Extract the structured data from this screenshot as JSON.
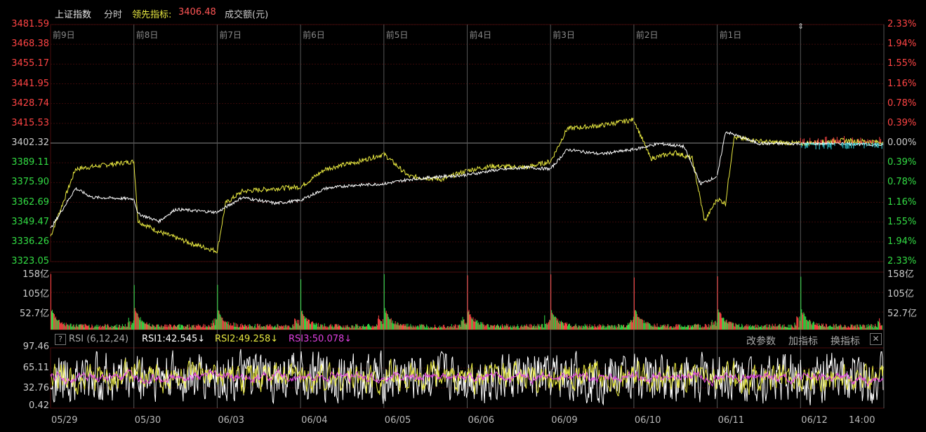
{
  "header": {
    "index_name": "上证指数",
    "period": "分时",
    "leading_label": "领先指标:",
    "leading_value": "3406.48",
    "volume_label": "成交额(元)"
  },
  "colors": {
    "up": "#ff4444",
    "down": "#33dd44",
    "price_line": "#ffffff",
    "leading_line": "#e8e840",
    "rsi1": "#ffffff",
    "rsi2": "#e8e840",
    "rsi3": "#e040e0",
    "grid": "#3a0a0a",
    "day_sep": "#555555",
    "ref_line": "#8a8a8a",
    "avg_cyan": "#33e0e8"
  },
  "price_axis": {
    "left_labels": [
      "3481.59",
      "3468.38",
      "3455.17",
      "3441.95",
      "3428.74",
      "3415.53",
      "3402.32",
      "3389.11",
      "3375.90",
      "3362.69",
      "3349.47",
      "3336.26",
      "3323.05"
    ],
    "right_labels": [
      "2.33%",
      "1.94%",
      "1.55%",
      "1.16%",
      "0.78%",
      "0.39%",
      "0.00%",
      "0.39%",
      "0.78%",
      "1.16%",
      "1.55%",
      "1.94%",
      "2.33%"
    ],
    "reference": 3402.32,
    "max": 3481.59,
    "min": 3323.05
  },
  "day_labels": [
    "前9日",
    "前8日",
    "前7日",
    "前6日",
    "前5日",
    "前4日",
    "前3日",
    "前2日",
    "前1日"
  ],
  "volume_axis": {
    "left_labels": [
      "158亿",
      "105亿",
      "52.7亿"
    ],
    "right_labels": [
      "158亿",
      "105亿",
      "52.7亿"
    ]
  },
  "rsi": {
    "help": "?",
    "name": "RSI (6,12,24)",
    "rsi1_label": "RSI1:42.545↓",
    "rsi2_label": "RSI2:49.258↓",
    "rsi3_label": "RSI3:50.078↓",
    "axis_labels": [
      "97.46",
      "65.11",
      "32.76",
      "0.42"
    ],
    "buttons": {
      "modify": "改参数",
      "add": "加指标",
      "switch": "换指标",
      "close": "✕"
    }
  },
  "x_axis_labels": [
    "05/29",
    "05/30",
    "06/03",
    "06/04",
    "06/05",
    "06/06",
    "06/09",
    "06/10",
    "06/11",
    "06/12",
    "14:00"
  ],
  "chart_data": {
    "type": "line",
    "title": "上证指数",
    "days": [
      "05/29",
      "05/30",
      "06/03",
      "06/04",
      "06/05",
      "06/06",
      "06/09",
      "06/10",
      "06/11",
      "06/12"
    ],
    "series": [
      {
        "name": "上证指数",
        "key_points": [
          [
            0,
            3345
          ],
          [
            0.3,
            3372
          ],
          [
            0.5,
            3366
          ],
          [
            1.0,
            3365
          ],
          [
            1.05,
            3355
          ],
          [
            1.3,
            3350
          ],
          [
            1.5,
            3358
          ],
          [
            2.0,
            3356
          ],
          [
            2.3,
            3366
          ],
          [
            2.7,
            3362
          ],
          [
            3.0,
            3364
          ],
          [
            3.3,
            3372
          ],
          [
            3.6,
            3374
          ],
          [
            4.0,
            3375
          ],
          [
            4.3,
            3378
          ],
          [
            4.7,
            3380
          ],
          [
            5.0,
            3381
          ],
          [
            5.3,
            3384
          ],
          [
            5.7,
            3386
          ],
          [
            6.0,
            3385
          ],
          [
            6.2,
            3398
          ],
          [
            6.6,
            3395
          ],
          [
            7.0,
            3398
          ],
          [
            7.3,
            3402
          ],
          [
            7.6,
            3400
          ],
          [
            7.8,
            3375
          ],
          [
            8.0,
            3380
          ],
          [
            8.1,
            3410
          ],
          [
            8.5,
            3402
          ],
          [
            9.0,
            3402
          ],
          [
            9.5,
            3402
          ],
          [
            9.99,
            3401
          ]
        ]
      },
      {
        "name": "领先指标",
        "key_points": [
          [
            0,
            3340
          ],
          [
            0.3,
            3385
          ],
          [
            0.7,
            3388
          ],
          [
            1.0,
            3390
          ],
          [
            1.05,
            3350
          ],
          [
            1.3,
            3343
          ],
          [
            1.7,
            3335
          ],
          [
            2.0,
            3330
          ],
          [
            2.1,
            3362
          ],
          [
            2.3,
            3370
          ],
          [
            2.7,
            3372
          ],
          [
            3.0,
            3373
          ],
          [
            3.3,
            3385
          ],
          [
            3.7,
            3390
          ],
          [
            4.0,
            3395
          ],
          [
            4.3,
            3380
          ],
          [
            4.7,
            3378
          ],
          [
            5.0,
            3384
          ],
          [
            5.3,
            3387
          ],
          [
            5.7,
            3386
          ],
          [
            6.0,
            3390
          ],
          [
            6.2,
            3412
          ],
          [
            6.6,
            3414
          ],
          [
            7.0,
            3418
          ],
          [
            7.2,
            3392
          ],
          [
            7.5,
            3396
          ],
          [
            7.7,
            3392
          ],
          [
            7.85,
            3350
          ],
          [
            8.0,
            3365
          ],
          [
            8.1,
            3362
          ],
          [
            8.2,
            3406
          ],
          [
            8.6,
            3403
          ],
          [
            9.0,
            3402
          ],
          [
            9.5,
            3404
          ],
          [
            9.99,
            3403
          ]
        ]
      }
    ],
    "ylim": [
      3323.05,
      3481.59
    ],
    "volume_ylim": [
      0,
      158
    ],
    "volume_unit": "亿",
    "rsi_ylim": [
      0.42,
      97.46
    ],
    "grid": true
  }
}
